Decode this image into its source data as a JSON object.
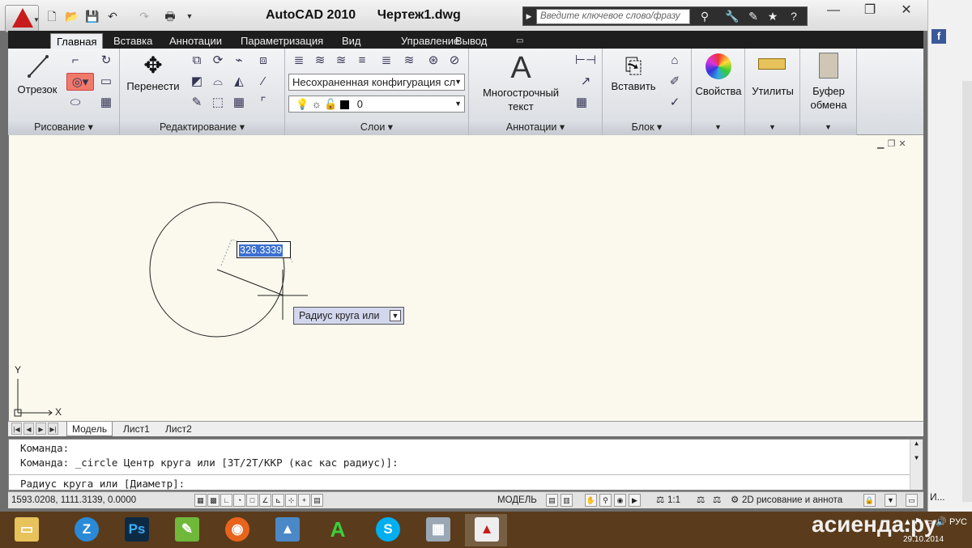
{
  "app": {
    "title": "AutoCAD 2010      Чертеж1.dwg",
    "search_placeholder": "Введите ключевое слово/фразу"
  },
  "menu_tabs": [
    "Главная",
    "Вставка",
    "Аннотации",
    "Параметризация",
    "Вид",
    "Управление",
    "Вывод"
  ],
  "ribbon": {
    "draw": {
      "line_label": "Отрезок",
      "footer": "Рисование"
    },
    "modify": {
      "move_label": "Перенести",
      "footer": "Редактирование"
    },
    "layers": {
      "layer_state": "Несохраненная конфигурация сл",
      "current_layer": "0",
      "footer": "Слои"
    },
    "annotation": {
      "mtext_label_1": "Многострочный",
      "mtext_label_2": "текст",
      "footer": "Аннотации"
    },
    "block": {
      "insert_label": "Вставить",
      "footer": "Блок"
    },
    "properties": {
      "label": "Свойства"
    },
    "utilities": {
      "label": "Утилиты"
    },
    "clipboard": {
      "label_1": "Буфер",
      "label_2": "обмена"
    }
  },
  "drawing": {
    "dim_input": "326.3339",
    "tooltip": "Радиус круга или",
    "axis_x": "X",
    "axis_y": "Y"
  },
  "layout_tabs": [
    "Модель",
    "Лист1",
    "Лист2"
  ],
  "command_lines": [
    "Команда:",
    "Команда: _circle Центр круга или [3Т/2Т/ККР (кас кас радиус)]:",
    "Радиус круга или [Диаметр]:"
  ],
  "status": {
    "coords": "1593.0208, 1111.3139, 0.0000",
    "model": "МОДЕЛЬ",
    "scale": "1:1",
    "workspace": "2D рисование и аннота"
  },
  "taskbar": {
    "date": "29.10.2014",
    "watermark": "асиенда.ру"
  },
  "side": {
    "label": "И..."
  }
}
